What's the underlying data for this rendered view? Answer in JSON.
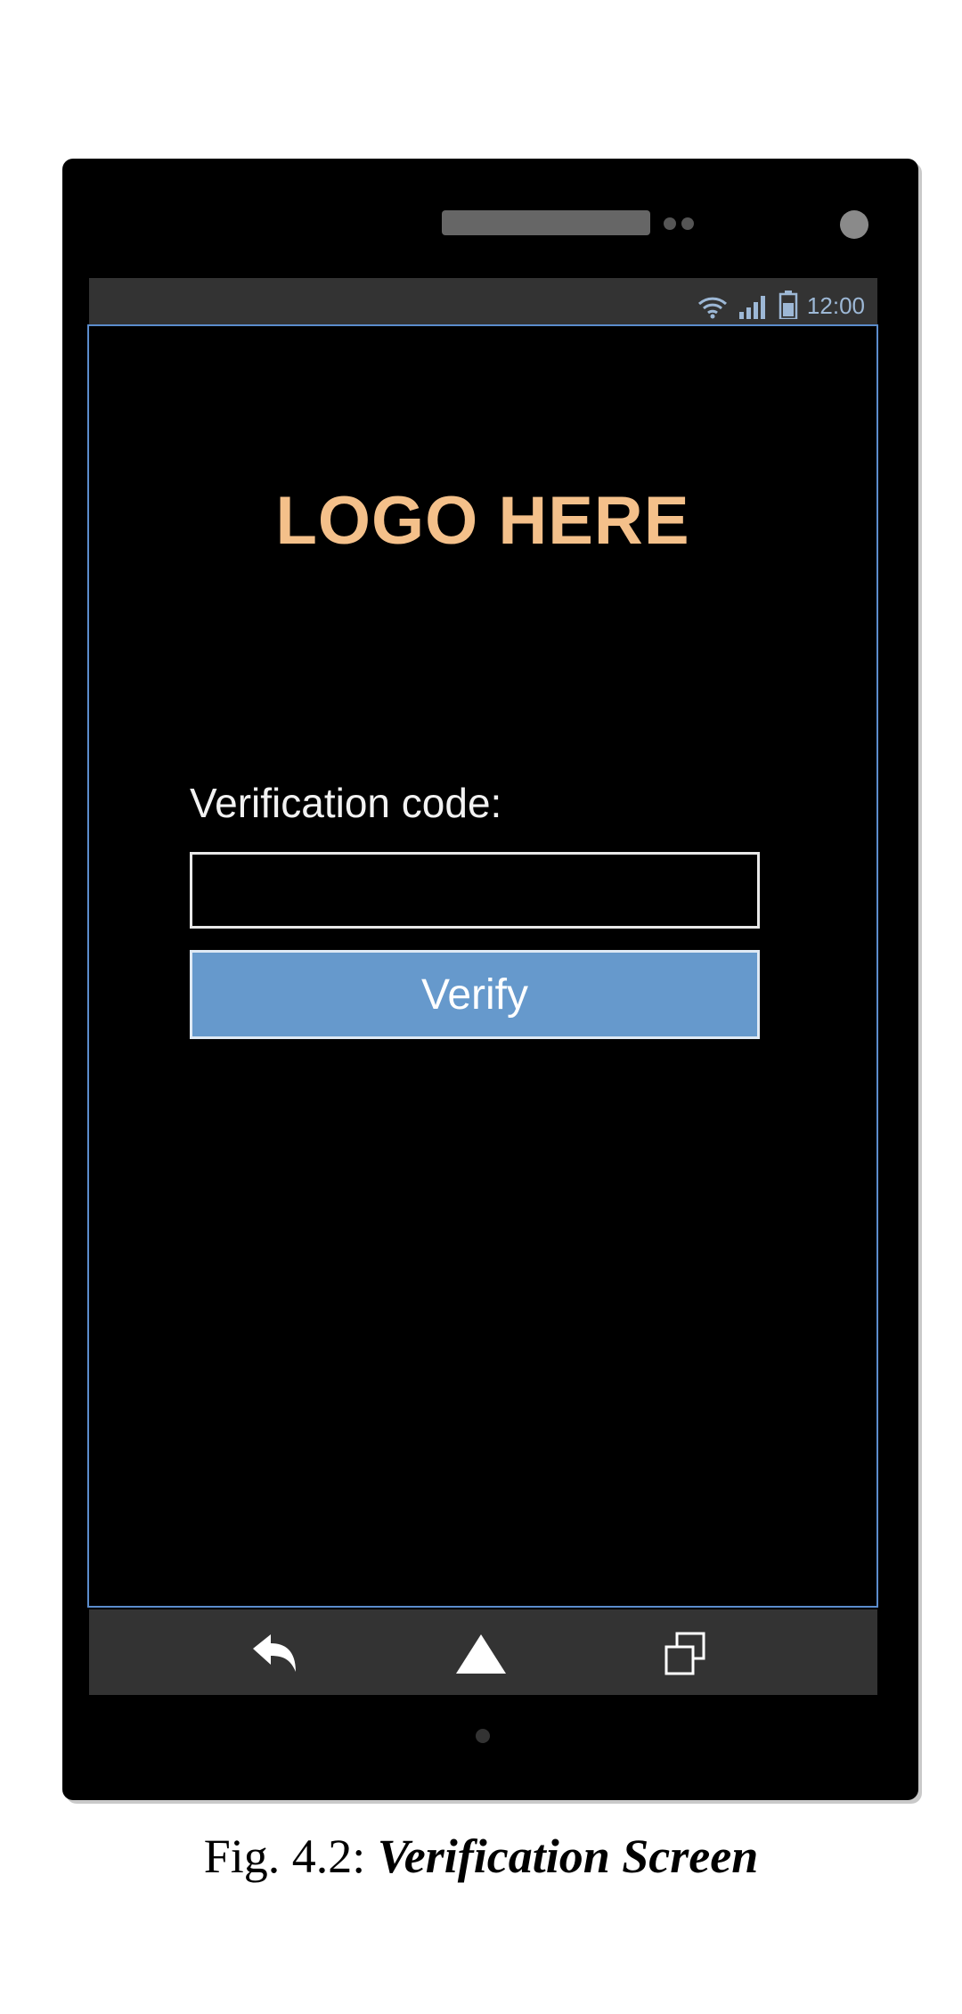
{
  "status_bar": {
    "time": "12:00",
    "icons": [
      "wifi-icon",
      "signal-icon",
      "battery-icon"
    ]
  },
  "logo": {
    "text": "LOGO HERE",
    "color": "#f4c08a"
  },
  "form": {
    "label": "Verification code:",
    "input_value": "",
    "input_placeholder": "",
    "button_label": "Verify",
    "button_color": "#6699cc"
  },
  "nav_bar": {
    "icons": [
      "back-icon",
      "home-icon",
      "recent-apps-icon"
    ]
  },
  "caption": {
    "prefix": "Fig. 4.2: ",
    "title": "Verification Screen"
  }
}
